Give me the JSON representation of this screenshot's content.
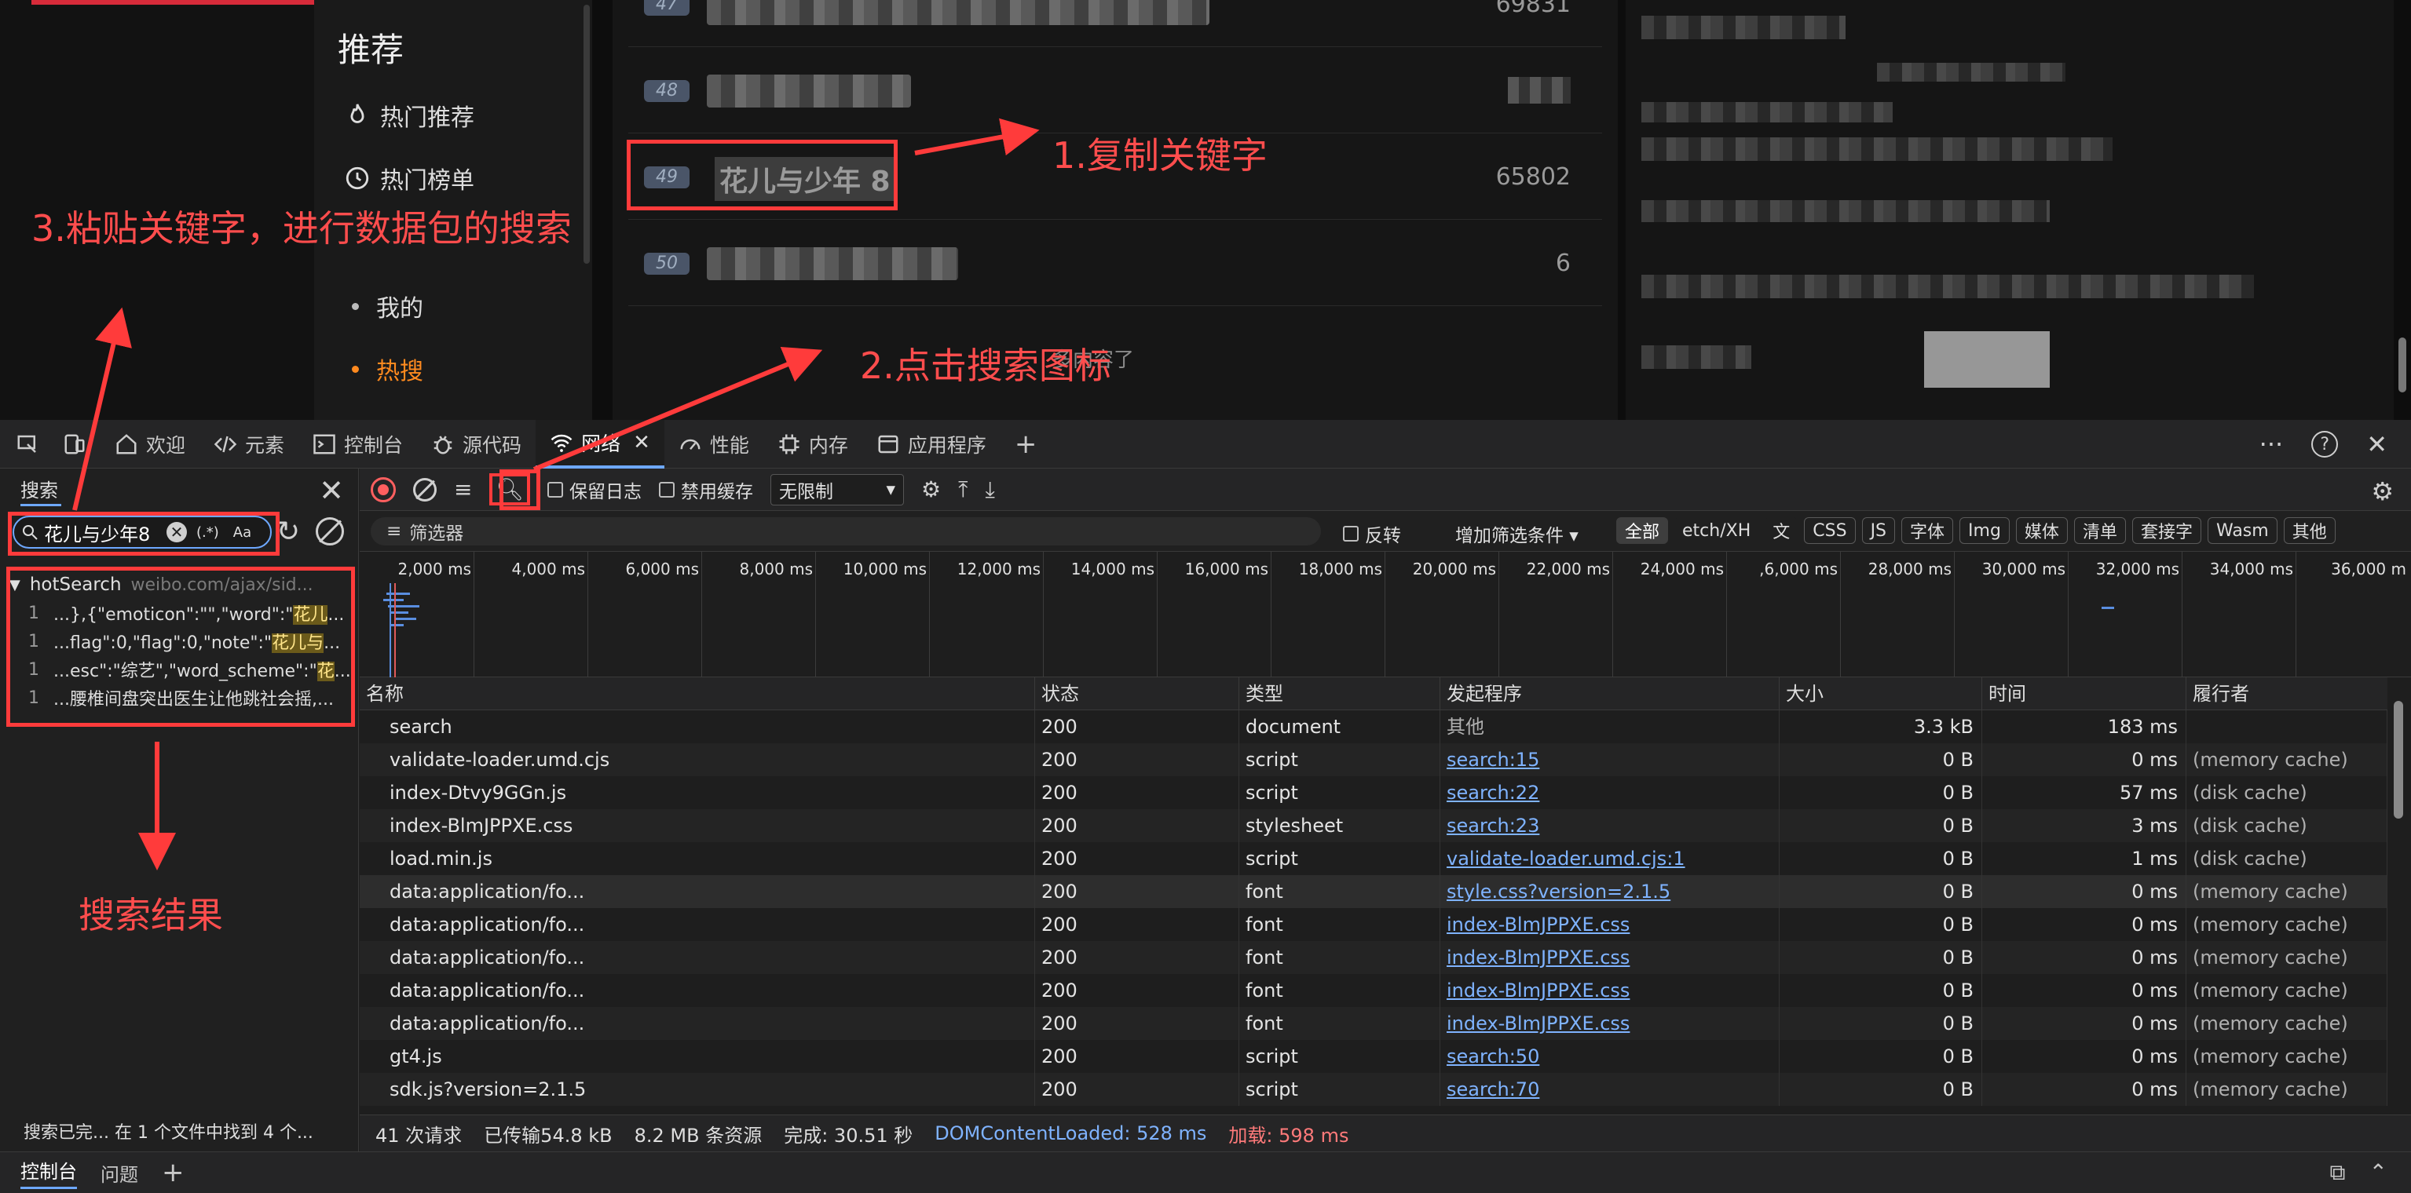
{
  "page": {
    "nav_title": "推荐",
    "nav_items": [
      {
        "label": "热门推荐",
        "icon": "flame-icon"
      },
      {
        "label": "热门榜单",
        "icon": "clock-icon"
      }
    ],
    "nav_sub": [
      {
        "label": "我的",
        "active": false
      },
      {
        "label": "热搜",
        "active": true
      }
    ],
    "rows": [
      {
        "rank": "47",
        "count": "69831",
        "blurred": true
      },
      {
        "rank": "48",
        "count": "",
        "blurred": true
      },
      {
        "rank": "49",
        "word": "花儿与少年 8",
        "count": "65802",
        "blurred": false
      },
      {
        "rank": "50",
        "count": "6",
        "blurred": true
      }
    ],
    "no_more": "多内容了"
  },
  "tabs": {
    "items": [
      {
        "label": "欢迎",
        "icon": "home-icon",
        "active": false
      },
      {
        "label": "元素",
        "icon": "code-icon",
        "active": false
      },
      {
        "label": "控制台",
        "icon": "console-icon",
        "active": false
      },
      {
        "label": "源代码",
        "icon": "bug-icon",
        "active": false
      },
      {
        "label": "网络",
        "icon": "wifi-icon",
        "active": true
      },
      {
        "label": "性能",
        "icon": "gauge-icon",
        "active": false
      },
      {
        "label": "内存",
        "icon": "chip-icon",
        "active": false
      },
      {
        "label": "应用程序",
        "icon": "window-icon",
        "active": false
      }
    ],
    "add": "+",
    "more": "···",
    "help": "?",
    "close": "✕"
  },
  "search": {
    "title": "搜索",
    "query": "花儿与少年8",
    "regex_label": "(.*)",
    "case_label": "Aa",
    "result_file": "hotSearch",
    "result_url": "weibo.com/ajax/sid...",
    "lines": [
      {
        "n": "1",
        "pre": "...},{\"emoticon\":\"\",\"word\":\"",
        "hit": "花儿",
        "post": "..."
      },
      {
        "n": "1",
        "pre": "...flag\":0,\"flag\":0,\"note\":\"",
        "hit": "花儿与",
        "post": "..."
      },
      {
        "n": "1",
        "pre": "...esc\":\"综艺\",\"word_scheme\":\"",
        "hit": "花",
        "post": "..."
      },
      {
        "n": "1",
        "pre": "...腰椎间盘突出医生让他跳社会摇,...",
        "hit": "",
        "post": ""
      }
    ],
    "status": "搜索已完...  在 1 个文件中找到 4 个..."
  },
  "toolbar": {
    "preserve_log": "保留日志",
    "disable_cache": "禁用缓存",
    "throttle": "无限制"
  },
  "filter": {
    "placeholder": "筛选器",
    "invert": "反转",
    "more_filters": "增加筛选条件 ▾",
    "chips": [
      "全部",
      "etch/XH",
      "文",
      "CSS",
      "JS",
      "字体",
      "Img",
      "媒体",
      "清单",
      "套接字",
      "Wasm",
      "其他"
    ]
  },
  "timeline": {
    "ticks": [
      "2,000 ms",
      "4,000 ms",
      "6,000 ms",
      "8,000 ms",
      "10,000 ms",
      "12,000 ms",
      "14,000 ms",
      "16,000 ms",
      "18,000 ms",
      "20,000 ms",
      "22,000 ms",
      "24,000 ms",
      ",6,000 ms",
      "28,000 ms",
      "30,000 ms",
      "32,000 ms",
      "34,000 ms",
      "36,000 m"
    ]
  },
  "table": {
    "headers": [
      "名称",
      "状态",
      "类型",
      "发起程序",
      "大小",
      "时间",
      "履行者"
    ],
    "rows": [
      {
        "name": "search",
        "status": "200",
        "type": "document",
        "initiator": "其他",
        "init_link": false,
        "size": "3.3 kB",
        "time": "183 ms",
        "fulfilled": ""
      },
      {
        "name": "validate-loader.umd.cjs",
        "status": "200",
        "type": "script",
        "initiator": "search:15",
        "init_link": true,
        "size": "0 B",
        "time": "0 ms",
        "fulfilled": "(memory cache)"
      },
      {
        "name": "index-Dtvy9GGn.js",
        "status": "200",
        "type": "script",
        "initiator": "search:22",
        "init_link": true,
        "size": "0 B",
        "time": "57 ms",
        "fulfilled": "(disk cache)"
      },
      {
        "name": "index-BlmJPPXE.css",
        "status": "200",
        "type": "stylesheet",
        "initiator": "search:23",
        "init_link": true,
        "size": "0 B",
        "time": "3 ms",
        "fulfilled": "(disk cache)"
      },
      {
        "name": "load.min.js",
        "status": "200",
        "type": "script",
        "initiator": "validate-loader.umd.cjs:1",
        "init_link": true,
        "size": "0 B",
        "time": "1 ms",
        "fulfilled": "(disk cache)"
      },
      {
        "name": "data:application/fo...",
        "status": "200",
        "type": "font",
        "initiator": "style.css?version=2.1.5",
        "init_link": true,
        "size": "0 B",
        "time": "0 ms",
        "fulfilled": "(memory cache)"
      },
      {
        "name": "data:application/fo...",
        "status": "200",
        "type": "font",
        "initiator": "index-BlmJPPXE.css",
        "init_link": true,
        "size": "0 B",
        "time": "0 ms",
        "fulfilled": "(memory cache)"
      },
      {
        "name": "data:application/fo...",
        "status": "200",
        "type": "font",
        "initiator": "index-BlmJPPXE.css",
        "init_link": true,
        "size": "0 B",
        "time": "0 ms",
        "fulfilled": "(memory cache)"
      },
      {
        "name": "data:application/fo...",
        "status": "200",
        "type": "font",
        "initiator": "index-BlmJPPXE.css",
        "init_link": true,
        "size": "0 B",
        "time": "0 ms",
        "fulfilled": "(memory cache)"
      },
      {
        "name": "data:application/fo...",
        "status": "200",
        "type": "font",
        "initiator": "index-BlmJPPXE.css",
        "init_link": true,
        "size": "0 B",
        "time": "0 ms",
        "fulfilled": "(memory cache)"
      },
      {
        "name": "gt4.js",
        "status": "200",
        "type": "script",
        "initiator": "search:50",
        "init_link": true,
        "size": "0 B",
        "time": "0 ms",
        "fulfilled": "(memory cache)"
      },
      {
        "name": "sdk.js?version=2.1.5",
        "status": "200",
        "type": "script",
        "initiator": "search:70",
        "init_link": true,
        "size": "0 B",
        "time": "0 ms",
        "fulfilled": "(memory cache)"
      }
    ]
  },
  "status": {
    "requests": "41 次请求",
    "transferred": "已传输54.8 kB",
    "resources": "8.2 MB 条资源",
    "finish": "完成: 30.51 秒",
    "dcl": "DOMContentLoaded: 528 ms",
    "load": "加载: 598 ms"
  },
  "drawer": {
    "console": "控制台",
    "issues": "问题",
    "add": "+"
  },
  "annotations": {
    "step1": "1.复制关键字",
    "step2": "2.点击搜索图标",
    "step3": "3.粘贴关键字，进行数据包的搜索",
    "result": "搜索结果",
    "color": "#ff3b3b"
  }
}
